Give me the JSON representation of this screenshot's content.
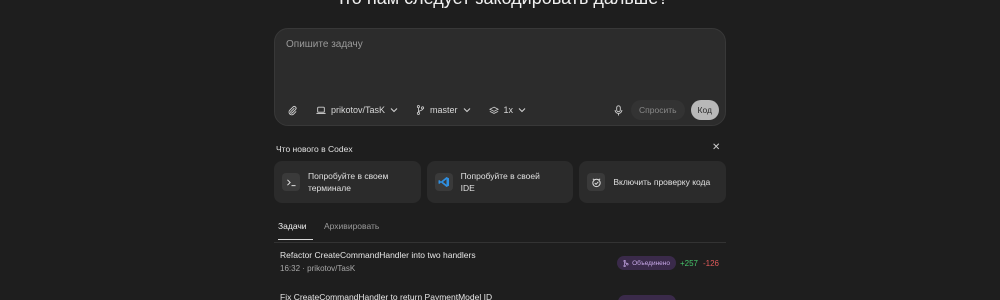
{
  "header": {
    "title": "Что нам следует закодировать дальше?"
  },
  "composer": {
    "placeholder": "Опишите задачу",
    "repo": "prikotov/TasK",
    "branch": "master",
    "versions": "1x",
    "ask_label": "Спросить",
    "code_label": "Код"
  },
  "news": {
    "title": "Что нового в Codex",
    "cards": [
      {
        "line1": "Попробуйте в своем",
        "line2": "терминале",
        "icon": "terminal-icon"
      },
      {
        "line1": "Попробуйте в своей",
        "line2": "IDE",
        "icon": "vscode-icon"
      },
      {
        "line1": "Включить проверку кода",
        "line2": "",
        "icon": "review-icon"
      }
    ]
  },
  "tabs": [
    {
      "label": "Задачи",
      "active": true
    },
    {
      "label": "Архивировать",
      "active": false
    }
  ],
  "tasks": [
    {
      "title": "Refactor CreateCommandHandler into two handlers",
      "time": "16:32",
      "repo": "prikotov/TasK",
      "status": "Объединено",
      "additions": "+257",
      "deletions": "-126"
    },
    {
      "title": "Fix CreateCommandHandler to return PaymentModel ID",
      "time": "",
      "repo": "",
      "status": "",
      "additions": "",
      "deletions": ""
    }
  ],
  "colors": {
    "background": "#1e1e1e",
    "merged_badge": "#3a2a4a",
    "additions": "#46c46a",
    "deletions": "#e05a5a"
  }
}
